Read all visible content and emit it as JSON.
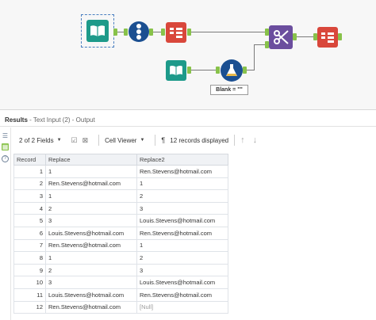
{
  "canvas": {
    "blank_label": "Blank = \"\""
  },
  "results": {
    "title": "Results",
    "crumb": " - Text Input (2) - Output"
  },
  "toolbar": {
    "fields": "2 of 2 Fields",
    "viewer": "Cell Viewer",
    "records": "12 records displayed"
  },
  "table": {
    "headers": [
      "Record",
      "Replace",
      "Replace2"
    ],
    "rows": [
      [
        "1",
        "1",
        "Ren.Stevens@hotmail.com"
      ],
      [
        "2",
        "Ren.Stevens@hotmail.com",
        "1"
      ],
      [
        "3",
        "1",
        "2"
      ],
      [
        "4",
        "2",
        "3"
      ],
      [
        "5",
        "3",
        "Louis.Stevens@hotmail.com"
      ],
      [
        "6",
        "Louis.Stevens@hotmail.com",
        "Ren.Stevens@hotmail.com"
      ],
      [
        "7",
        "Ren.Stevens@hotmail.com",
        "1"
      ],
      [
        "8",
        "1",
        "2"
      ],
      [
        "9",
        "2",
        "3"
      ],
      [
        "10",
        "3",
        "Louis.Stevens@hotmail.com"
      ],
      [
        "11",
        "Louis.Stevens@hotmail.com",
        "Ren.Stevens@hotmail.com"
      ],
      [
        "12",
        "Ren.Stevens@hotmail.com",
        "[Null]"
      ]
    ]
  },
  "colors": {
    "input_tool": "#1d9a8a",
    "record_id_tool": "#1b4f91",
    "select_tool": "#d9473b",
    "join_tool": "#6b4e9e",
    "formula_tool": "#1b4f91",
    "anchor": "#88c24a"
  },
  "icons": [
    "book-icon",
    "record-id-icon",
    "select-icon",
    "join-icon",
    "formula-flask-icon",
    "table-grid-icon",
    "help-icon"
  ]
}
